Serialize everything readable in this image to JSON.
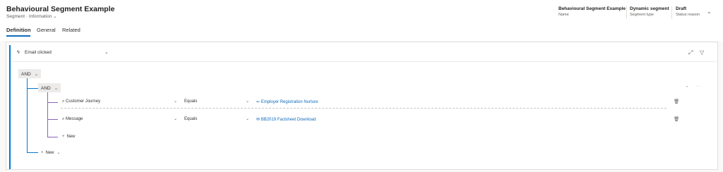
{
  "header": {
    "title": "Behavioural Segment Example",
    "entity": "Segment",
    "separator": "·",
    "form": "Information",
    "form_chevron": "⌄",
    "fields": [
      {
        "value": "Behavioural Segment Example",
        "label": "Name"
      },
      {
        "value": "Dynamic segment",
        "label": "Segment type"
      },
      {
        "value": "Draft",
        "label": "Status reason"
      }
    ],
    "expand_chevron": "⌄"
  },
  "tabs": [
    {
      "label": "Definition",
      "active": true
    },
    {
      "label": "General"
    },
    {
      "label": "Related"
    }
  ],
  "builder": {
    "trigger_icon": "ϟ",
    "trigger": "Email clicked",
    "trigger_chevron": "⌄",
    "expand_icon": "⤢",
    "filter_icon": "▽",
    "outer_operator": "AND",
    "inner_operator": "AND",
    "chevron": "⌄",
    "caret_up": "⌃",
    "ellipsis": "···",
    "conditions": [
      {
        "search_icon": "⌕",
        "entity": "Customer Journey",
        "operator": "Equals",
        "value_icon": "⇚",
        "value": "Employer Registration Nurture",
        "delete_icon": "🗑"
      },
      {
        "search_icon": "⌕",
        "entity": "Message",
        "operator": "Equals",
        "value_icon": "✉",
        "value": "BB2019 Factsheet Download",
        "delete_icon": "🗑"
      }
    ],
    "inner_new": {
      "plus": "+",
      "label": "New"
    },
    "outer_new": {
      "plus": "+",
      "label": "New",
      "chevron": "⌄"
    }
  },
  "colors": {
    "accent": "#0078d4",
    "group_line": "#8764b8",
    "link": "#0f6cbd"
  }
}
